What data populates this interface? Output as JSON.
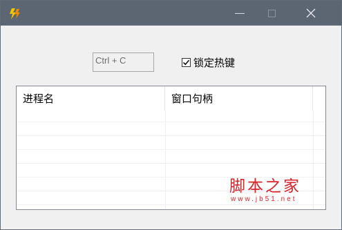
{
  "titlebar": {
    "icon": "lightning-bolt-icon",
    "buttons": [
      "minimize",
      "maximize",
      "close"
    ]
  },
  "hotkey": {
    "value": "Ctrl + C"
  },
  "lock": {
    "label": "锁定热键",
    "checked": true
  },
  "table": {
    "columns": [
      "进程名",
      "窗口句柄"
    ],
    "rows": []
  },
  "watermark": {
    "title": "脚本之家",
    "url": "www.jb51.net",
    "color": "#d9232a"
  }
}
